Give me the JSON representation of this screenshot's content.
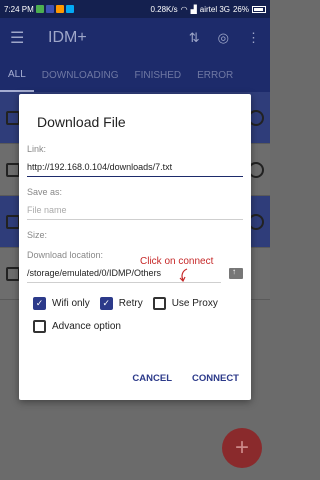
{
  "status": {
    "time": "7:24 PM",
    "net": "0.28K/s",
    "carrier": "airtel 3G",
    "battery": "26%"
  },
  "appbar": {
    "title": "IDM+"
  },
  "tabs": [
    "ALL",
    "DOWNLOADING",
    "FINISHED",
    "ERROR"
  ],
  "dialog": {
    "title": "Download File",
    "link_label": "Link:",
    "link_value": "http://192.168.0.104/downloads/7.txt",
    "saveas_label": "Save as:",
    "saveas_placeholder": "File name",
    "size_label": "Size:",
    "location_label": "Download location:",
    "location_value": "/storage/emulated/0/IDMP/Others",
    "checks": [
      {
        "label": "Wifi only",
        "checked": true
      },
      {
        "label": "Retry",
        "checked": true
      },
      {
        "label": "Use Proxy",
        "checked": false
      },
      {
        "label": "Advance option",
        "checked": false
      }
    ],
    "cancel_label": "CANCEL",
    "connect_label": "CONNECT"
  },
  "annotation": "Click on connect",
  "colors": {
    "primary": "#1d2b6b",
    "accent": "#c62828"
  }
}
